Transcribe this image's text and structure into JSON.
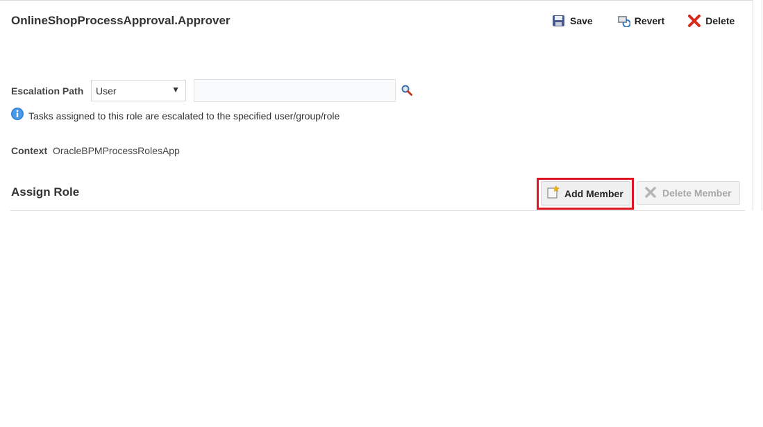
{
  "header": {
    "title": "OnlineShopProcessApproval.Approver",
    "save_label": "Save",
    "revert_label": "Revert",
    "delete_label": "Delete"
  },
  "escalation": {
    "label": "Escalation Path",
    "selected": "User",
    "input_value": "",
    "info_text": "Tasks assigned to this role are escalated to the specified user/group/role"
  },
  "context": {
    "label": "Context",
    "value": "OracleBPMProcessRolesApp"
  },
  "assign": {
    "title": "Assign Role",
    "add_member_label": "Add Member",
    "delete_member_label": "Delete Member"
  },
  "colors": {
    "highlight": "#e0141e",
    "disabled_text": "#a8a8a8"
  },
  "icons": {
    "save": "floppy-disk-icon",
    "revert": "revert-icon",
    "delete": "red-x-icon",
    "search": "magnifier-icon",
    "info": "info-icon",
    "add_member": "add-document-icon",
    "delete_member": "gray-x-icon"
  }
}
